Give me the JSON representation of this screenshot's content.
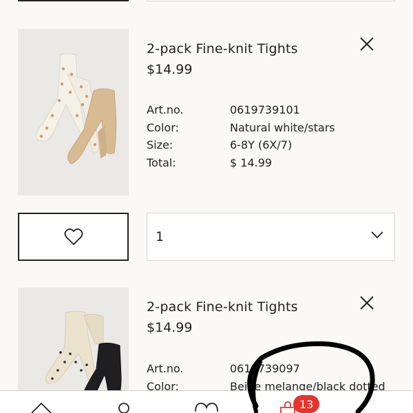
{
  "cart": {
    "items": [
      {
        "image_icon": "tights-natural-white-stars-image",
        "name": "2-pack Fine-knit Tights",
        "price": "$14.99",
        "labels": {
          "artno": "Art.no.",
          "color": "Color:",
          "size": "Size:",
          "total": "Total:"
        },
        "artno": "0619739101",
        "color": "Natural white/stars",
        "size": "6-8Y (6X/7)",
        "total": "$ 14.99",
        "quantity": "1",
        "favorite_icon": "heart-outline-icon",
        "remove_icon": "close-icon",
        "dropdown_icon": "chevron-down-icon"
      },
      {
        "image_icon": "tights-beige-black-dotted-image",
        "name": "2-pack Fine-knit Tights",
        "price": "$14.99",
        "labels": {
          "artno": "Art.no.",
          "color": "Color:"
        },
        "artno": "0619739097",
        "color": "Beige melange/black dotted",
        "remove_icon": "close-icon"
      }
    ]
  },
  "nav": {
    "icons": [
      "home-icon",
      "account-icon",
      "favorites-icon",
      "shopping-bag-icon"
    ],
    "bag_count": "13"
  },
  "colors": {
    "accent_badge": "#e9342c",
    "text": "#222222",
    "background": "#faf9f8"
  }
}
